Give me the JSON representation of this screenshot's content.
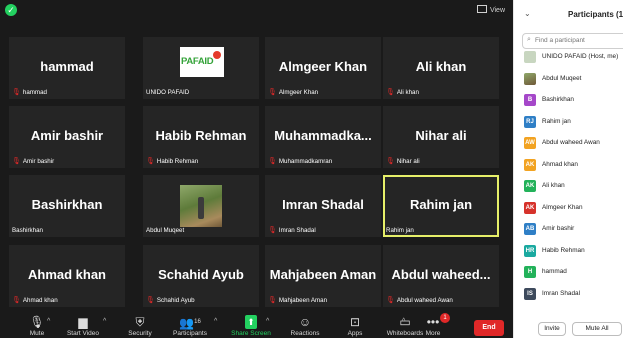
{
  "meeting": {
    "view_label": "View",
    "tiles": [
      {
        "name": "hammad",
        "label": "hammad",
        "muted": true,
        "type": "name"
      },
      {
        "name": "",
        "label": "UNIDO PAFAID",
        "muted": false,
        "type": "logo",
        "logo_text": "PAFAID"
      },
      {
        "name": "Almgeer Khan",
        "label": "Almgeer Khan",
        "muted": true,
        "type": "name"
      },
      {
        "name": "Ali khan",
        "label": "Ali khan",
        "muted": true,
        "type": "name"
      },
      {
        "name": "Amir bashir",
        "label": "Amir bashir",
        "muted": true,
        "type": "name"
      },
      {
        "name": "Habib Rehman",
        "label": "Habib Rehman",
        "muted": true,
        "type": "name"
      },
      {
        "name": "Muhammadka...",
        "label": "Muhammadkamran",
        "muted": true,
        "type": "name"
      },
      {
        "name": "Nihar ali",
        "label": "Nihar ali",
        "muted": true,
        "type": "name"
      },
      {
        "name": "Bashirkhan",
        "label": "Bashirkhan",
        "muted": false,
        "type": "name"
      },
      {
        "name": "",
        "label": "Abdul Muqeet",
        "muted": false,
        "type": "photo"
      },
      {
        "name": "Imran Shadal",
        "label": "Imran Shadal",
        "muted": true,
        "type": "name"
      },
      {
        "name": "Rahim jan",
        "label": "Rahim jan",
        "muted": false,
        "type": "name",
        "active": true
      },
      {
        "name": "Ahmad khan",
        "label": "Ahmad khan",
        "muted": true,
        "type": "name"
      },
      {
        "name": "Schahid Ayub",
        "label": "Schahid Ayub",
        "muted": true,
        "type": "name"
      },
      {
        "name": "Mahjabeen Aman",
        "label": "Mahjabeen Aman",
        "muted": true,
        "type": "name"
      },
      {
        "name": "Abdul waheed...",
        "label": "Abdul waheed Awan",
        "muted": true,
        "type": "name"
      }
    ]
  },
  "toolbar": {
    "items": [
      {
        "label": "Mute",
        "icon": "microphone-icon"
      },
      {
        "label": "Start Video",
        "icon": "video-off-icon"
      },
      {
        "label": "Security",
        "icon": "shield-icon"
      },
      {
        "label": "Participants",
        "icon": "participants-icon",
        "count": "16"
      },
      {
        "label": "Share Screen",
        "icon": "share-screen-icon"
      },
      {
        "label": "Reactions",
        "icon": "reactions-icon"
      },
      {
        "label": "Apps",
        "icon": "apps-icon"
      },
      {
        "label": "Whiteboards",
        "icon": "whiteboard-icon"
      },
      {
        "label": "More",
        "icon": "more-icon",
        "badge": "1"
      }
    ],
    "end_label": "End",
    "share_color": "#23d160",
    "end_color": "#e02828"
  },
  "panel": {
    "title": "Participants (16)",
    "search_placeholder": "Find a participant",
    "participants": [
      {
        "name": "UNIDO PAFAID (Host, me)",
        "initials": "",
        "color": "#c8d6c0",
        "avatar": "logo"
      },
      {
        "name": "Abdul Muqeet",
        "initials": "",
        "color": "#8fa86a",
        "avatar": "photo"
      },
      {
        "name": "Bashirkhan",
        "initials": "B",
        "color": "#a547c9"
      },
      {
        "name": "Rahim jan",
        "initials": "RJ",
        "color": "#2f7fc6"
      },
      {
        "name": "Abdul waheed Awan",
        "initials": "AW",
        "color": "#f2a322"
      },
      {
        "name": "Ahmad khan",
        "initials": "AK",
        "color": "#f2a322"
      },
      {
        "name": "Ali khan",
        "initials": "AK",
        "color": "#23b25a"
      },
      {
        "name": "Almgeer Khan",
        "initials": "AK",
        "color": "#d6322b"
      },
      {
        "name": "Amir bashir",
        "initials": "AB",
        "color": "#2f7fc6"
      },
      {
        "name": "Habib Rehman",
        "initials": "HR",
        "color": "#1aa9a0"
      },
      {
        "name": "hammad",
        "initials": "H",
        "color": "#23b25a"
      },
      {
        "name": "Imran Shadal",
        "initials": "IS",
        "color": "#3d4a5c"
      }
    ],
    "invite_label": "Invite",
    "mute_all_label": "Mute All"
  }
}
